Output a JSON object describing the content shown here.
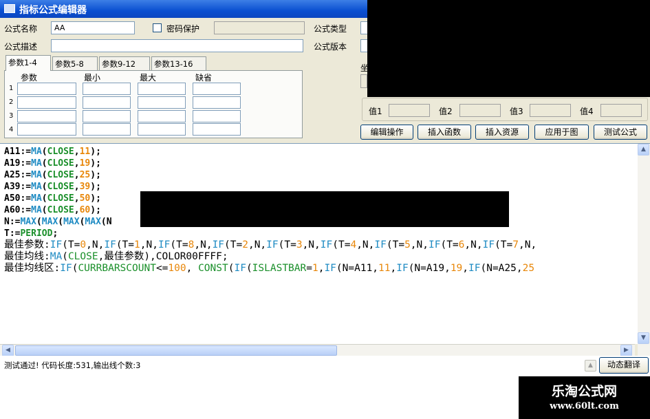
{
  "window": {
    "title": "指标公式编辑器"
  },
  "form": {
    "name_label": "公式名称",
    "name_value": "AA",
    "password_label": "密码保护",
    "type_label": "公式类型",
    "desc_label": "公式描述",
    "desc_value": "",
    "version_label": "公式版本"
  },
  "params": {
    "tabs": [
      "参数1-4",
      "参数5-8",
      "参数9-12",
      "参数13-16"
    ],
    "columns": [
      "参数",
      "最小",
      "最大",
      "缺省"
    ],
    "rows": [
      "1",
      "2",
      "3",
      "4"
    ]
  },
  "axis_group": {
    "label_visible": "坐",
    "value_labels": [
      "值1",
      "值2",
      "值3",
      "值4"
    ]
  },
  "buttons": [
    "编辑操作",
    "插入函数",
    "插入资源",
    "应用于图",
    "测试公式"
  ],
  "code": {
    "lines": [
      "A11:=MA(CLOSE,11);",
      "A19:=MA(CLOSE,19);",
      "A25:=MA(CLOSE,25);",
      "A39:=MA(CLOSE,39);",
      "A50:=MA(CLOSE,50);",
      "A60:=MA(CLOSE,60);",
      "N:=MAX(MAX(MAX(MAX(N",
      "T:=PERIOD;",
      "最佳参数:IF(T=0,N,IF(T=1,N,IF(T=8,N,IF(T=2,N,IF(T=3,N,IF(T=4,N,IF(T=5,N,IF(T=6,N,IF(T=7,N,",
      "最佳均线:MA(CLOSE,最佳参数),COLOR00FFFF;",
      "最佳均线区:IF(CURRBARSCOUNT<=100, CONST(IF(ISLASTBAR=1,IF(N=A11,11,IF(N=A19,19,IF(N=A25,25"
    ]
  },
  "status": {
    "message": "测试通过! 代码长度:531,输出线个数:3",
    "translate_button": "动态翻译"
  },
  "watermark": {
    "line1": "乐淘公式网",
    "line2": "www.60lt.com"
  },
  "colors": {
    "titlebar": "#0a4fd1",
    "function": "#1e8bc3",
    "number": "#e8870a",
    "keyword": "#1a8f2a"
  }
}
